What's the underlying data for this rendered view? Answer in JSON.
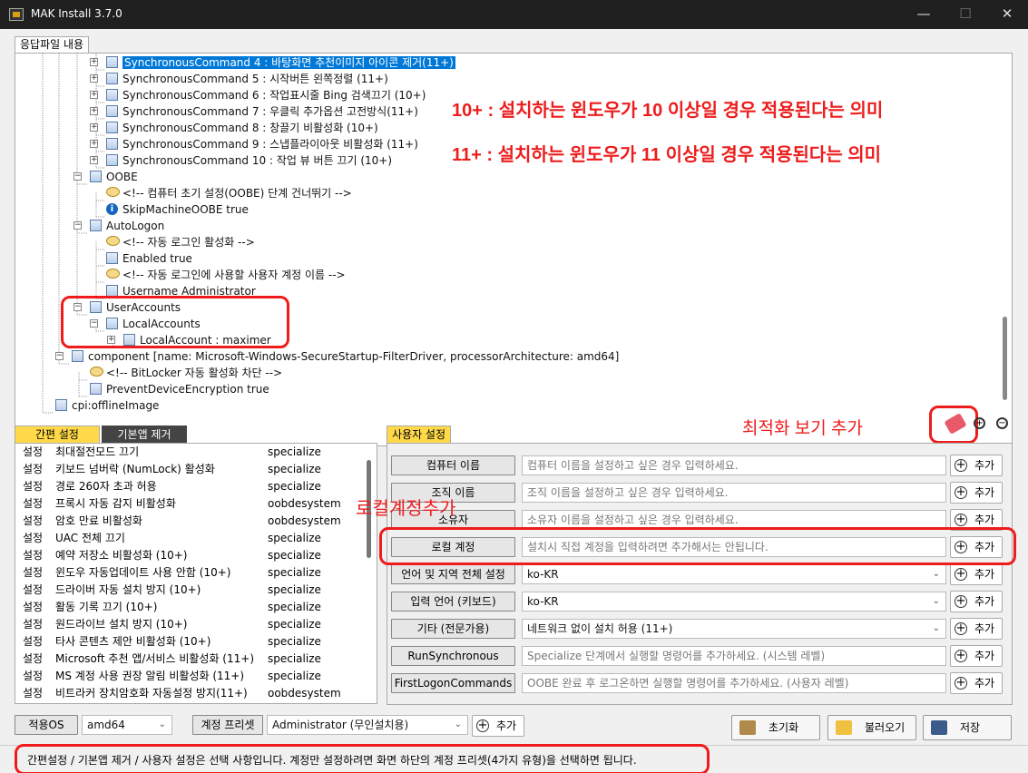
{
  "window": {
    "title": "MAK Install 3.7.0",
    "minimize": "—",
    "maximize": "☐",
    "close": "✕"
  },
  "top_tab": "응답파일 내용",
  "tree": [
    {
      "label": "SynchronousCommand  4 : 바탕화면 추천이미지 아이콘 제거(11+)",
      "selected": true
    },
    {
      "label": "SynchronousCommand  5 : 시작버튼 왼쪽정렬 (11+)"
    },
    {
      "label": "SynchronousCommand  6 : 작업표시줄 Bing 검색끄기 (10+)"
    },
    {
      "label": "SynchronousCommand  7 : 우클릭 추가옵션 고전방식(11+)"
    },
    {
      "label": "SynchronousCommand  8 : 창끌기 비활성화 (10+)"
    },
    {
      "label": "SynchronousCommand  9 : 스냅플라이아웃 비활성화 (11+)"
    },
    {
      "label": "SynchronousCommand  10 : 작업 뷰 버튼 끄기 (10+)"
    },
    {
      "label": "OOBE"
    },
    {
      "label": "<!-- 컴퓨터 초기 설정(OOBE) 단계 건너뛰기 -->"
    },
    {
      "label": "SkipMachineOOBE true"
    },
    {
      "label": "AutoLogon"
    },
    {
      "label": "<!-- 자동 로그인 활성화 -->"
    },
    {
      "label": "Enabled true"
    },
    {
      "label": "<!-- 자동 로그인에 사용할 사용자 계정 이름 -->"
    },
    {
      "label": "Username Administrator"
    },
    {
      "label": "UserAccounts"
    },
    {
      "label": "LocalAccounts"
    },
    {
      "label": "LocalAccount  : maximer"
    },
    {
      "label": "component  [name: Microsoft-Windows-SecureStartup-FilterDriver, processorArchitecture: amd64]"
    },
    {
      "label": "<!-- BitLocker 자동 활성화 차단 -->"
    },
    {
      "label": "PreventDeviceEncryption true"
    },
    {
      "label": "cpi:offlineImage"
    }
  ],
  "annotations": {
    "note10": "10+ : 설치하는 윈도우가 10 이상일 경우 적용된다는 의미",
    "note11": "11+ : 설치하는 윈도우가 11 이상일 경우 적용된다는 의미",
    "optimize": "최적화 보기 추가",
    "local": "로컬계정추가"
  },
  "left_tabs": [
    "간편 설정",
    "기본앱 제거"
  ],
  "settings": [
    [
      "설정",
      "최대절전모드 끄기",
      "specialize"
    ],
    [
      "설정",
      "키보드 넘버락 (NumLock) 활성화",
      "specialize"
    ],
    [
      "설정",
      "경로 260자 초과 허용",
      "specialize"
    ],
    [
      "설정",
      "프록시 자동 감지 비활성화",
      "oobdesystem"
    ],
    [
      "설정",
      "암호 만료 비활성화",
      "oobdesystem"
    ],
    [
      "설정",
      "UAC 전체 끄기",
      "specialize"
    ],
    [
      "설정",
      "예약 저장소 비활성화 (10+)",
      "specialize"
    ],
    [
      "설정",
      "윈도우 자동업데이트 사용 안함 (10+)",
      "specialize"
    ],
    [
      "설정",
      "드라이버 자동 설치 방지 (10+)",
      "specialize"
    ],
    [
      "설정",
      "활동 기록 끄기 (10+)",
      "specialize"
    ],
    [
      "설정",
      "원드라이브 설치 방지 (10+)",
      "specialize"
    ],
    [
      "설정",
      "타사 콘텐츠 제안 비활성화 (10+)",
      "specialize"
    ],
    [
      "설정",
      "Microsoft 추천 앱/서비스 비활성화 (11+)",
      "specialize"
    ],
    [
      "설정",
      "MS 계정 사용 권장 알림 비활성화 (11+)",
      "specialize"
    ],
    [
      "설정",
      "비트라커 장치암호화 자동설정 방지(11+)",
      "oobdesystem"
    ]
  ],
  "user_tab": "사용자 설정",
  "user_rows": [
    {
      "label": "컴퓨터 이름",
      "placeholder": "컴퓨터 이름을 설정하고 싶은 경우 입력하세요.",
      "combo": false
    },
    {
      "label": "조직 이름",
      "placeholder": "조직 이름을 설정하고 싶은 경우 입력하세요.",
      "combo": false
    },
    {
      "label": "소유자",
      "placeholder": "소유자 이름을 설정하고 싶은 경우 입력하세요.",
      "combo": false
    },
    {
      "label": "로컬 계정",
      "placeholder": "설치시 직접 계정을 입력하려면 추가해서는 안됩니다.",
      "combo": false
    },
    {
      "label": "언어 및 지역 전체 설정",
      "value": "ko-KR",
      "combo": true
    },
    {
      "label": "입력 언어 (키보드)",
      "value": "ko-KR",
      "combo": true
    },
    {
      "label": "기타 (전문가용)",
      "value": "네트워크 없이 설치 허용 (11+)",
      "combo": true
    },
    {
      "label": "RunSynchronous",
      "placeholder": "Specialize 단계에서 실행할 명령어를 추가하세요. (시스템 레벨)",
      "combo": false
    },
    {
      "label": "FirstLogonCommands",
      "placeholder": "OOBE 완료 후 로그온하면 실행할 명령어를 추가하세요. (사용자 레벨)",
      "combo": false
    }
  ],
  "add_label": "추가",
  "bottom": {
    "os_label": "적용OS",
    "os_value": "amd64",
    "preset_label": "계정 프리셋",
    "preset_value": "Administrator (무인설치용)",
    "add": "추가",
    "reset": "초기화",
    "load": "불러오기",
    "save": "저장"
  },
  "status_text": "간편설정 / 기본앱 제거 / 사용자 설정은 선택 사항입니다. 계정만 설정하려면 화면 하단의 계정 프리셋(4가지 유형)을 선택하면 됩니다."
}
